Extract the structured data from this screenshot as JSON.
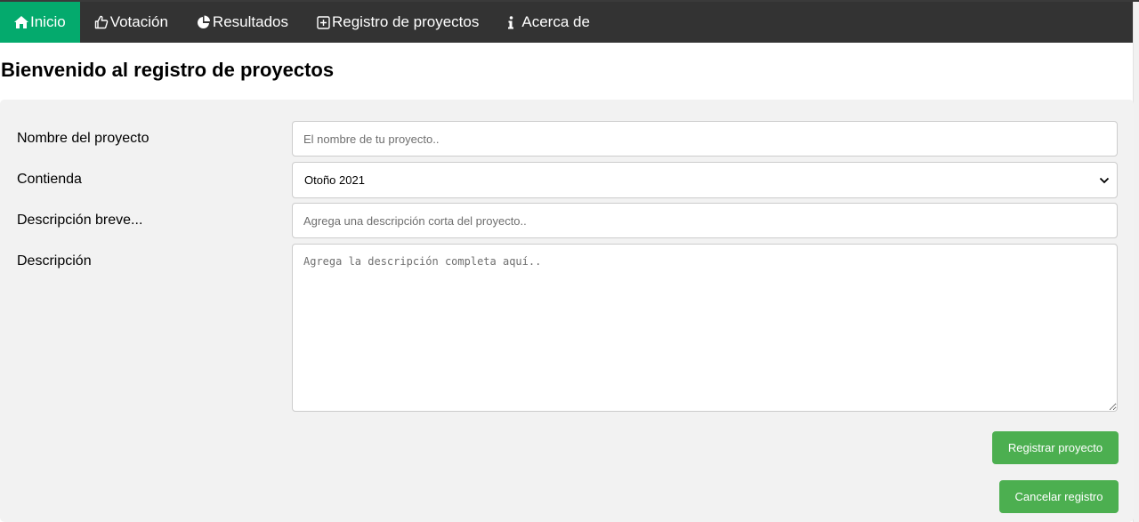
{
  "nav": {
    "items": [
      {
        "label": "Inicio",
        "icon": "home-icon",
        "active": true
      },
      {
        "label": "Votación",
        "icon": "thumbs-up-icon",
        "active": false
      },
      {
        "label": "Resultados",
        "icon": "pie-chart-icon",
        "active": false
      },
      {
        "label": "Registro de proyectos",
        "icon": "plus-square-icon",
        "active": false
      },
      {
        "label": "Acerca de",
        "icon": "info-icon",
        "active": false
      }
    ],
    "bar_color": "#333333",
    "active_color": "#04AA6D"
  },
  "page": {
    "title": "Bienvenido al registro de proyectos"
  },
  "form": {
    "name": {
      "label": "Nombre del proyecto",
      "placeholder": "El nombre de tu proyecto..",
      "value": ""
    },
    "contest": {
      "label": "Contienda",
      "selected": "Otoño 2021"
    },
    "short_description": {
      "label": "Descripción breve...",
      "placeholder": "Agrega una descripción corta del proyecto..",
      "value": ""
    },
    "description": {
      "label": "Descripción",
      "placeholder": "Agrega la descripción completa aquí..",
      "value": ""
    },
    "submit_label": "Registrar proyecto",
    "cancel_label": "Cancelar registro",
    "button_color": "#4CAF50"
  }
}
